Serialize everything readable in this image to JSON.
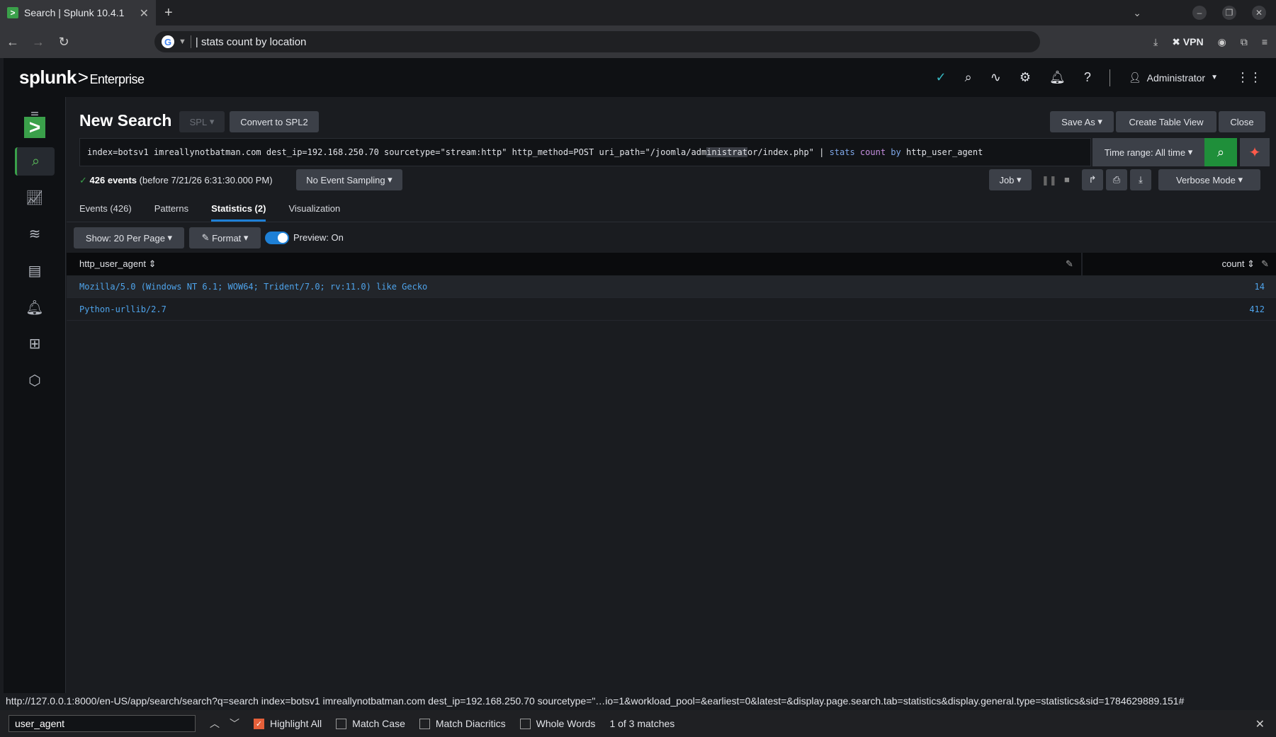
{
  "browser": {
    "tab_title": "Search | Splunk 10.4.1",
    "tab_close": "✕",
    "new_tab": "+",
    "address": "| stats count by location",
    "vpn_label": "VPN"
  },
  "header": {
    "logo_main": "splunk",
    "logo_sep": ">",
    "logo_product": "Enterprise",
    "user_label": "Administrator"
  },
  "search": {
    "page_title": "New Search",
    "spl_label": "SPL",
    "convert_label": "Convert to SPL2",
    "save_as_label": "Save As",
    "create_table_label": "Create Table View",
    "close_label": "Close",
    "query_part1": "index=botsv1 imreallynotbatman.com dest_ip=192.168.250.70 sourcetype=\"stream:http\" http_method=POST uri_path=\"/joomla/adm",
    "query_highlight": "inistrat",
    "query_part2": "or/index.php\" | ",
    "query_cmd": "stats",
    "query_fn": " count",
    "query_by": " by",
    "query_field": " http_user_agent",
    "time_range_label": "Time range: All time",
    "events_count": "426 events",
    "events_before": "(before 7/21/26 6:31:30.000 PM)",
    "sampling_label": "No Event Sampling",
    "job_label": "Job",
    "mode_label": "Verbose Mode"
  },
  "tabs": [
    {
      "label": "Events (426)"
    },
    {
      "label": "Patterns"
    },
    {
      "label": "Statistics (2)"
    },
    {
      "label": "Visualization"
    }
  ],
  "results_toolbar": {
    "per_page_label": "Show: 20 Per Page",
    "format_label": "Format",
    "preview_label": "Preview: On"
  },
  "table": {
    "col1": "http_user_agent",
    "col2": "count",
    "rows": [
      {
        "agent": "Mozilla/5.0 (Windows NT 6.1; WOW64; Trident/7.0; rv:11.0) like Gecko",
        "count": "14"
      },
      {
        "agent": "Python-urllib/2.7",
        "count": "412"
      }
    ]
  },
  "status_url": "http://127.0.0.1:8000/en-US/app/search/search?q=search index=botsv1 imreallynotbatman.com dest_ip=192.168.250.70 sourcetype=\"…io=1&workload_pool=&earliest=0&latest=&display.page.search.tab=statistics&display.general.type=statistics&sid=1784629889.151#",
  "findbar": {
    "query": "user_agent",
    "highlight_all": "Highlight All",
    "match_case": "Match Case",
    "match_diacritics": "Match Diacritics",
    "whole_words": "Whole Words",
    "result": "1 of 3 matches"
  },
  "colors": {
    "accent_green": "#3aa04a",
    "link_blue": "#4ea3ea",
    "tab_active": "#1e80d6"
  }
}
